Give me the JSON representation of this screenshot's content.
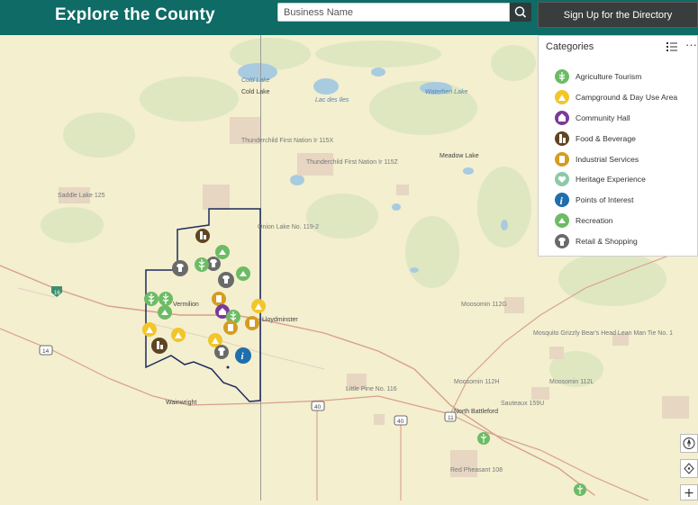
{
  "header": {
    "title": "Explore the County",
    "search_placeholder": "Business Name",
    "signup_label": "Sign Up for the Directory"
  },
  "panel": {
    "title": "Categories",
    "items": [
      {
        "label": "Agriculture Tourism",
        "color": "#6dbb65",
        "icon": "wheat-icon"
      },
      {
        "label": "Campground & Day Use Area",
        "color": "#f2c62a",
        "icon": "campfire-icon"
      },
      {
        "label": "Community Hall",
        "color": "#7a3a98",
        "icon": "hall-icon"
      },
      {
        "label": "Food & Beverage",
        "color": "#5e4524",
        "icon": "bottle-icon"
      },
      {
        "label": "Industrial Services",
        "color": "#d59c22",
        "icon": "industry-icon"
      },
      {
        "label": "Heritage Experience",
        "color": "#8cc9a8",
        "icon": "heritage-icon"
      },
      {
        "label": "Points of Interest",
        "color": "#1f6eae",
        "icon": "info-icon"
      },
      {
        "label": "Recreation",
        "color": "#6dbb65",
        "icon": "recreation-icon"
      },
      {
        "label": "Retail & Shopping",
        "color": "#6a6a6a",
        "icon": "shirt-icon"
      }
    ]
  },
  "map": {
    "places": [
      "Cold Lake",
      "Cold Lake",
      "Lac des Iles",
      "Waterhen Lake",
      "Thunderchild First Nation Ir 115X",
      "Thunderchild First Nation Ir 115Z",
      "Meadow Lake",
      "Saddle Lake 125",
      "Onion Lake No. 119-2",
      "Vermilion",
      "Lloydminster",
      "Moosomin 112G",
      "Mosquito Grizzly Bear's Head Lean Man Tie No. 1",
      "Moosomin 112H",
      "Moosomin 112L",
      "Little Pine No. 116",
      "Sauteaux 159U",
      "North Battleford",
      "Wainwright",
      "Red Pheasant 108"
    ],
    "highways": [
      "16",
      "14",
      "40",
      "40",
      "11"
    ]
  }
}
